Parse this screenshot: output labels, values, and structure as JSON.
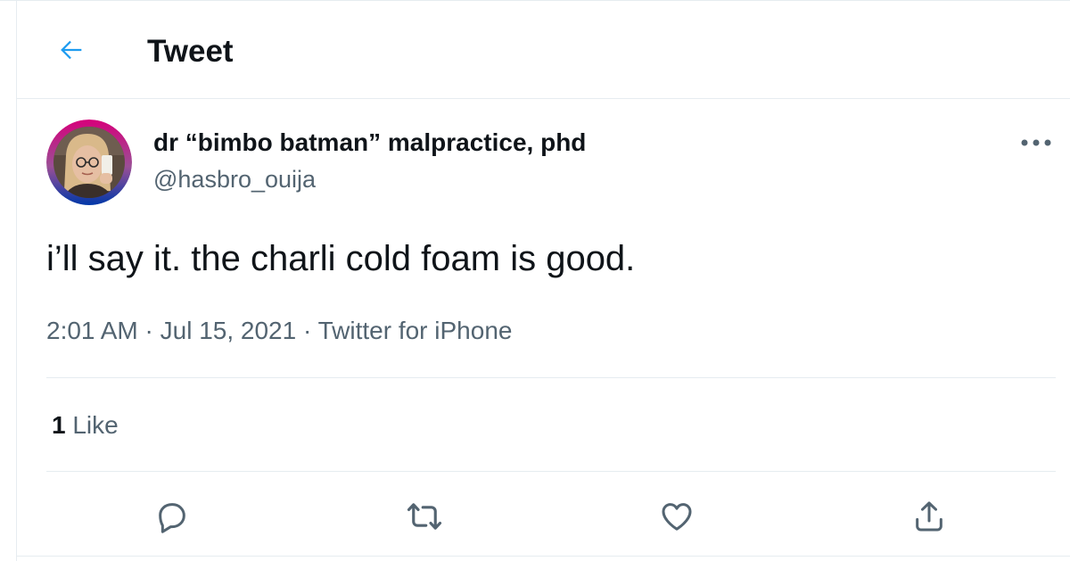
{
  "header": {
    "title": "Tweet",
    "back_icon": "arrow-left-icon"
  },
  "tweet": {
    "author": {
      "display_name": "dr “bimbo batman” malpractice, phd",
      "handle": "@hasbro_ouija",
      "avatar_ring_colors": [
        "#d6007a",
        "#9b4f96",
        "#0038a8"
      ]
    },
    "text": "i’ll say it. the charli cold foam is good.",
    "time": "2:01 AM",
    "separator": " · ",
    "date": "Jul 15, 2021",
    "source": "Twitter for iPhone",
    "likes": {
      "count": "1",
      "label": " Like"
    },
    "actions": [
      {
        "name": "reply",
        "icon": "reply-icon"
      },
      {
        "name": "retweet",
        "icon": "retweet-icon"
      },
      {
        "name": "like",
        "icon": "heart-icon"
      },
      {
        "name": "share",
        "icon": "share-icon"
      }
    ]
  },
  "colors": {
    "accent": "#1d9bf0",
    "text": "#0f1419",
    "secondary": "#536471",
    "divider": "#e6ecf0"
  }
}
